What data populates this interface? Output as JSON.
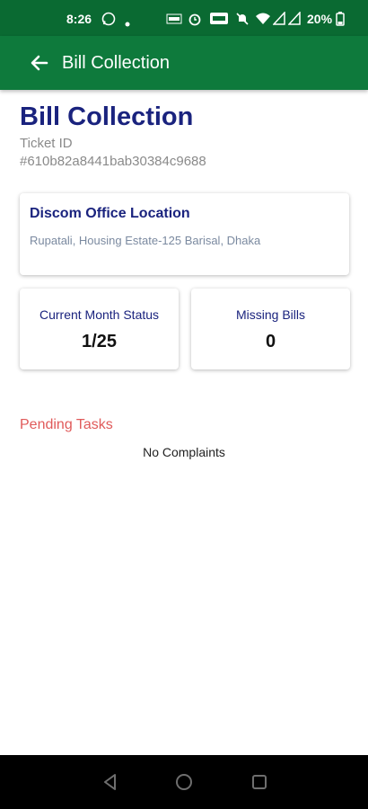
{
  "status_bar": {
    "time": "8:26",
    "battery": "20%",
    "icons": [
      "whatsapp-icon",
      "dot-icon",
      "network-speed-icon",
      "alarm-icon",
      "volte-icon",
      "mute-icon",
      "wifi-icon",
      "signal-icon",
      "signal-icon",
      "battery-icon"
    ]
  },
  "app_bar": {
    "title": "Bill Collection",
    "back_icon": "arrow-back-icon"
  },
  "header": {
    "title": "Bill Collection",
    "ticket_label": "Ticket ID",
    "ticket_id": "#610b82a8441bab30384c9688"
  },
  "location_card": {
    "title": "Discom Office Location",
    "value": "Rupatali, Housing Estate-125 Barisal, Dhaka"
  },
  "stats": [
    {
      "label": "Current Month Status",
      "value": "1/25"
    },
    {
      "label": "Missing Bills",
      "value": "0"
    }
  ],
  "pending": {
    "title": "Pending Tasks",
    "empty_message": "No Complaints"
  },
  "nav_bar": {
    "buttons": [
      "back-triangle-icon",
      "home-circle-icon",
      "recents-square-icon"
    ]
  },
  "colors": {
    "app_bar": "#0e7a3c",
    "status_bar": "#0a6a32",
    "title_navy": "#1a237e",
    "pending_red": "#e05a5a"
  }
}
